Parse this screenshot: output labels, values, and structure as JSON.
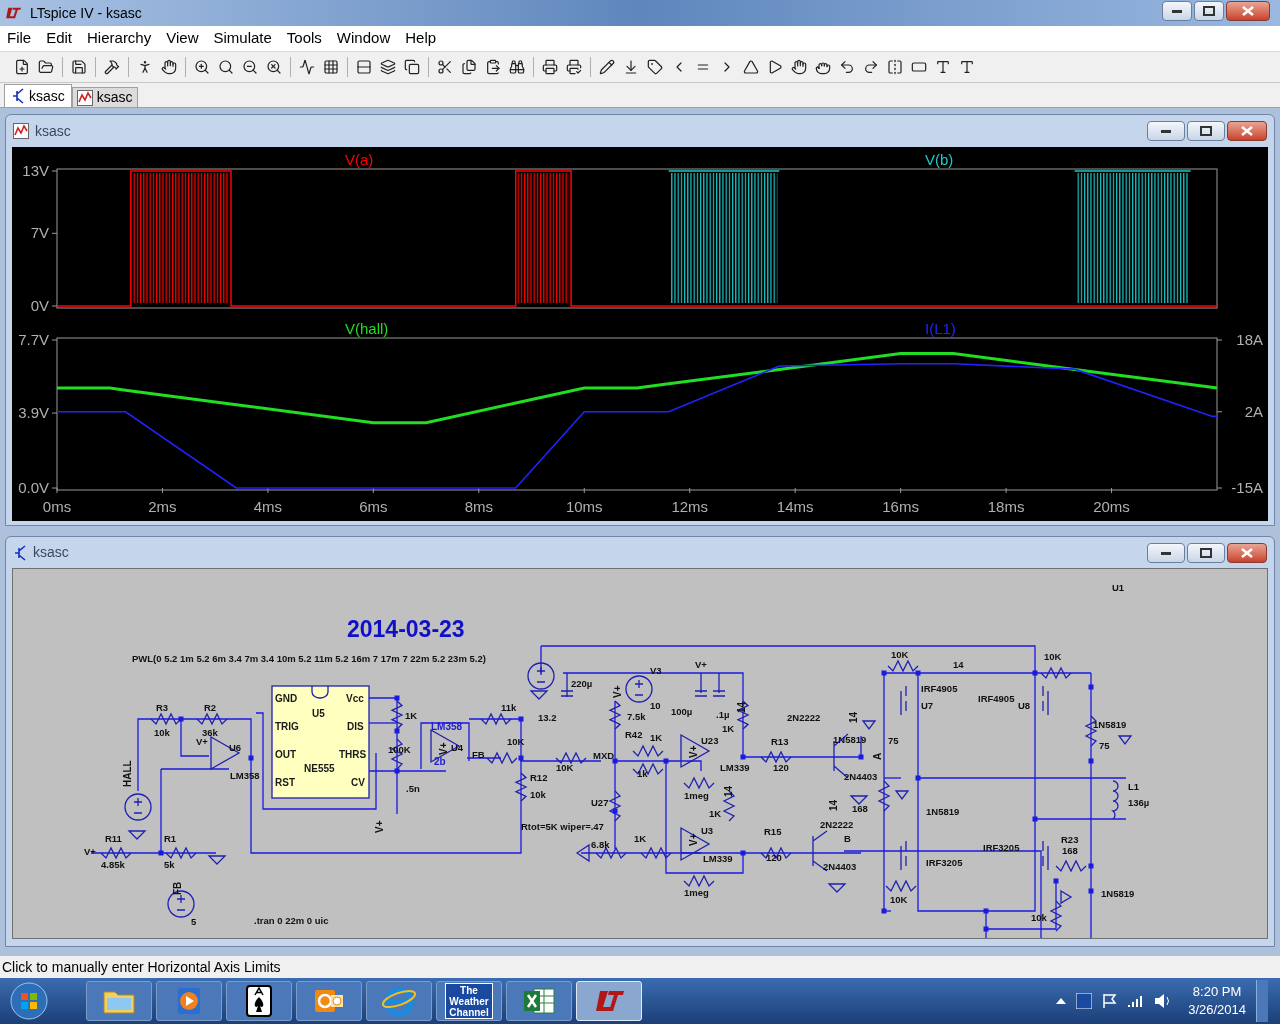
{
  "window": {
    "title": "LTspice IV - ksasc"
  },
  "menu": [
    "File",
    "Edit",
    "Hierarchy",
    "View",
    "Simulate",
    "Tools",
    "Window",
    "Help"
  ],
  "tabs": [
    {
      "label": "ksasc",
      "kind": "schematic",
      "selected": true
    },
    {
      "label": "ksasc",
      "kind": "waveform",
      "selected": false
    }
  ],
  "plot_window": {
    "title": "ksasc",
    "panes": [
      {
        "chart_data": {
          "type": "line",
          "x": [
            0,
            1.4,
            1.4,
            3.3,
            3.3,
            8.7,
            8.7,
            9.75,
            9.75,
            11.6,
            11.6,
            13.7,
            13.7,
            19.3,
            19.3,
            21.5,
            21.5,
            22
          ],
          "series": [
            {
              "name": "V(a)",
              "color": "#ff0000",
              "values": [
                0,
                0,
                13,
                13,
                0,
                0,
                13,
                13,
                0,
                0,
                0,
                0,
                0,
                0,
                0,
                0,
                0,
                0
              ]
            },
            {
              "name": "V(b)",
              "color": "#1ec8c8",
              "values": [
                null,
                null,
                null,
                null,
                null,
                null,
                null,
                null,
                null,
                null,
                13,
                13,
                null,
                null,
                13,
                13,
                null,
                null
              ]
            }
          ],
          "xlim": [
            0,
            22
          ],
          "ylim": [
            0,
            13
          ],
          "yticks": [
            {
              "value": 0,
              "label": "0V"
            },
            {
              "value": 7,
              "label": "7V"
            },
            {
              "value": 13,
              "label": "13V"
            }
          ]
        }
      },
      {
        "chart_data": {
          "type": "line",
          "x": [
            0,
            1,
            1.3,
            3.4,
            6,
            7,
            8.7,
            10,
            11,
            11.6,
            13.7,
            16,
            17,
            19.3,
            21.9,
            22
          ],
          "series": [
            {
              "name": "V(hall)",
              "color": "#22dd22",
              "values": [
                5.2,
                5.2,
                5.09,
                4.33,
                3.4,
                3.4,
                4.42,
                5.2,
                5.2,
                5.42,
                6.17,
                7,
                7,
                6.17,
                5.24,
                5.2
              ]
            },
            {
              "name": "I(L1)",
              "color": "#2222ff",
              "axis": "y2",
              "values": [
                2,
                2,
                2,
                -15,
                -15,
                -15,
                -15,
                2,
                2,
                2,
                12.2,
                12.7,
                12.7,
                11.5,
                1,
                1
              ]
            }
          ],
          "xlim": [
            0,
            22
          ],
          "ylim": [
            0,
            7.7
          ],
          "y2lim": [
            -15,
            18
          ],
          "xticks": [
            {
              "value": 0,
              "label": "0ms"
            },
            {
              "value": 2,
              "label": "2ms"
            },
            {
              "value": 4,
              "label": "4ms"
            },
            {
              "value": 6,
              "label": "6ms"
            },
            {
              "value": 8,
              "label": "8ms"
            },
            {
              "value": 10,
              "label": "10ms"
            },
            {
              "value": 12,
              "label": "12ms"
            },
            {
              "value": 14,
              "label": "14ms"
            },
            {
              "value": 16,
              "label": "16ms"
            },
            {
              "value": 18,
              "label": "18ms"
            },
            {
              "value": 20,
              "label": "20ms"
            }
          ],
          "yticks": [
            {
              "value": 0,
              "label": "0.0V"
            },
            {
              "value": 3.9,
              "label": "3.9V"
            },
            {
              "value": 7.7,
              "label": "7.7V"
            }
          ],
          "y2ticks": [
            {
              "value": -15,
              "label": "-15A"
            },
            {
              "value": 2,
              "label": "2A"
            },
            {
              "value": 18,
              "label": "18A"
            }
          ]
        }
      }
    ]
  },
  "schematic_window": {
    "title": "ksasc",
    "labels": [
      {
        "text": "2014-03-23",
        "kind": "title"
      },
      {
        "text": "PWL(0 5.2 1m 5.2 6m 3.4 7m 3.4 10m 5.2 11m 5.2 16m 7 17m 7 22m 5.2 23m 5.2)",
        "kind": "label"
      },
      {
        "text": "R3",
        "kind": "label"
      },
      {
        "text": "10k",
        "kind": "label"
      },
      {
        "text": "R2",
        "kind": "label"
      },
      {
        "text": "36k",
        "kind": "label"
      },
      {
        "text": "V+",
        "kind": "label"
      },
      {
        "text": "U6",
        "kind": "label"
      },
      {
        "text": "LM358",
        "kind": "label"
      },
      {
        "text": "GND",
        "kind": "chip"
      },
      {
        "text": "Vcc",
        "kind": "chip"
      },
      {
        "text": "U5",
        "kind": "chip"
      },
      {
        "text": "TRIG",
        "kind": "chip"
      },
      {
        "text": "DIS",
        "kind": "chip"
      },
      {
        "text": "OUT",
        "kind": "chip"
      },
      {
        "text": "THRS",
        "kind": "chip"
      },
      {
        "text": "NE555",
        "kind": "chip"
      },
      {
        "text": "RST",
        "kind": "chip"
      },
      {
        "text": "CV",
        "kind": "chip"
      },
      {
        "text": "1K",
        "kind": "label"
      },
      {
        "text": "100K",
        "kind": "label"
      },
      {
        "text": ".5n",
        "kind": "label"
      },
      {
        "text": "V+",
        "kind": "vertical"
      },
      {
        "text": "LM358",
        "kind": "blue"
      },
      {
        "text": "U4",
        "kind": "label"
      },
      {
        "text": "2b",
        "kind": "blue"
      },
      {
        "text": "V+",
        "kind": "vertical"
      },
      {
        "text": "11k",
        "kind": "label"
      },
      {
        "text": "10K",
        "kind": "label"
      },
      {
        "text": "FB",
        "kind": "label"
      },
      {
        "text": "R12",
        "kind": "label"
      },
      {
        "text": "10k",
        "kind": "label"
      },
      {
        "text": "Rtot=5K wiper=.47",
        "kind": "label"
      },
      {
        "text": "HALL",
        "kind": "vertical"
      },
      {
        "text": "R11",
        "kind": "label"
      },
      {
        "text": "V+",
        "kind": "label"
      },
      {
        "text": "4.85k",
        "kind": "label"
      },
      {
        "text": "R1",
        "kind": "label"
      },
      {
        "text": "5k",
        "kind": "label"
      },
      {
        "text": "FB",
        "kind": "vertical"
      },
      {
        "text": "5",
        "kind": "label"
      },
      {
        "text": ".tran 0 22m 0 uic",
        "kind": "label"
      },
      {
        "text": "220µ",
        "kind": "label"
      },
      {
        "text": "13.2",
        "kind": "label"
      },
      {
        "text": "V+",
        "kind": "vertical"
      },
      {
        "text": "V3",
        "kind": "label"
      },
      {
        "text": "10",
        "kind": "label"
      },
      {
        "text": "7.5k",
        "kind": "label"
      },
      {
        "text": "V+",
        "kind": "label"
      },
      {
        "text": "100µ",
        "kind": "label"
      },
      {
        "text": ".1µ",
        "kind": "label"
      },
      {
        "text": "14",
        "kind": "vertical"
      },
      {
        "text": "1K",
        "kind": "label"
      },
      {
        "text": "R42",
        "kind": "label"
      },
      {
        "text": "1K",
        "kind": "label"
      },
      {
        "text": "U23",
        "kind": "label"
      },
      {
        "text": "V+",
        "kind": "vertical"
      },
      {
        "text": "MXD",
        "kind": "label"
      },
      {
        "text": "10K",
        "kind": "label"
      },
      {
        "text": "1k",
        "kind": "label"
      },
      {
        "text": "LM339",
        "kind": "label"
      },
      {
        "text": "1meg",
        "kind": "label"
      },
      {
        "text": "U27",
        "kind": "label"
      },
      {
        "text": "14",
        "kind": "vertical"
      },
      {
        "text": "1K",
        "kind": "label"
      },
      {
        "text": "6.8k",
        "kind": "label"
      },
      {
        "text": "1K",
        "kind": "label"
      },
      {
        "text": "U3",
        "kind": "label"
      },
      {
        "text": "V+",
        "kind": "vertical"
      },
      {
        "text": "LM339",
        "kind": "label"
      },
      {
        "text": "1meg",
        "kind": "label"
      },
      {
        "text": "R13",
        "kind": "label"
      },
      {
        "text": "120",
        "kind": "label"
      },
      {
        "text": "R15",
        "kind": "label"
      },
      {
        "text": "120",
        "kind": "label"
      },
      {
        "text": "2N2222",
        "kind": "label"
      },
      {
        "text": "14",
        "kind": "vertical"
      },
      {
        "text": "1N5819",
        "kind": "label"
      },
      {
        "text": "2N4403",
        "kind": "label"
      },
      {
        "text": "168",
        "kind": "label"
      },
      {
        "text": "14",
        "kind": "vertical"
      },
      {
        "text": "2N2222",
        "kind": "label"
      },
      {
        "text": "B",
        "kind": "label"
      },
      {
        "text": "2N4403",
        "kind": "label"
      },
      {
        "text": "10K",
        "kind": "label"
      },
      {
        "text": "14",
        "kind": "label"
      },
      {
        "text": "IRF4905",
        "kind": "label"
      },
      {
        "text": "U7",
        "kind": "label"
      },
      {
        "text": "IRF4905",
        "kind": "label"
      },
      {
        "text": "U8",
        "kind": "label"
      },
      {
        "text": "75",
        "kind": "label"
      },
      {
        "text": "A",
        "kind": "vertical"
      },
      {
        "text": "10K",
        "kind": "label"
      },
      {
        "text": "1N5819",
        "kind": "label"
      },
      {
        "text": "75",
        "kind": "label"
      },
      {
        "text": "L1",
        "kind": "label"
      },
      {
        "text": "136µ",
        "kind": "label"
      },
      {
        "text": "1N5819",
        "kind": "label"
      },
      {
        "text": "IRF3205",
        "kind": "label"
      },
      {
        "text": "IRF3205",
        "kind": "label"
      },
      {
        "text": "R23",
        "kind": "label"
      },
      {
        "text": "168",
        "kind": "label"
      },
      {
        "text": "1N5819",
        "kind": "label"
      },
      {
        "text": "10K",
        "kind": "label"
      },
      {
        "text": "10k",
        "kind": "label"
      },
      {
        "text": "U1",
        "kind": "label"
      }
    ]
  },
  "status_bar": "Click to manually enter Horizontal Axis Limits",
  "taskbar": {
    "apps": [
      {
        "kind": "folder",
        "selected": false
      },
      {
        "kind": "media",
        "selected": false
      },
      {
        "kind": "cards",
        "selected": false
      },
      {
        "kind": "mail",
        "selected": false
      },
      {
        "kind": "browser",
        "selected": false
      },
      {
        "kind": "weather",
        "label": "The Weather Channel",
        "selected": false
      },
      {
        "kind": "sheet",
        "selected": false
      },
      {
        "kind": "ltspice",
        "selected": true
      }
    ],
    "time": "8:20 PM",
    "date": "3/26/2014"
  }
}
